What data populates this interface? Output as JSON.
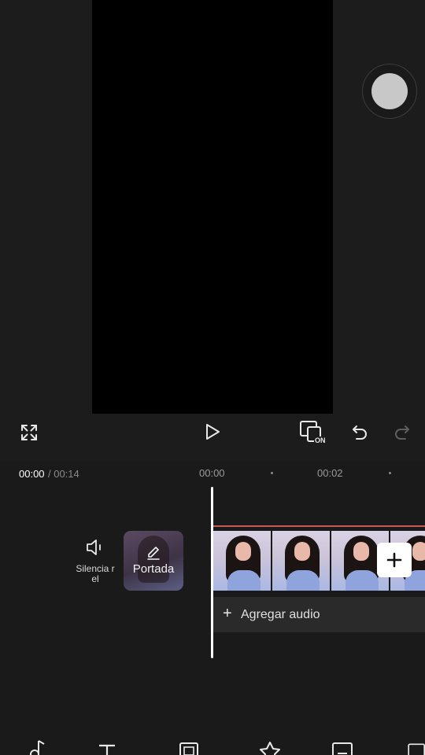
{
  "controls": {
    "fullscreen_icon": "fullscreen-expand-icon",
    "play_icon": "play-icon",
    "ratio_toggle_icon": "ratio-toggle-icon",
    "ratio_toggle_badge": "ON",
    "undo_icon": "undo-icon",
    "redo_icon": "redo-icon"
  },
  "timeline": {
    "current_time": "00:00",
    "total_time": "/ 00:14",
    "ruler_ticks": [
      "00:00",
      "00:02"
    ]
  },
  "track": {
    "mute_label": "Silencia r el",
    "cover_label": "Portada",
    "add_audio_label": "Agregar audio",
    "add_audio_plus": "+",
    "clip_frames": 4
  },
  "toolbar": {
    "items": [
      "music-icon",
      "text-icon",
      "sticker-icon",
      "effects-icon",
      "filters-icon",
      "format-icon"
    ]
  },
  "colors": {
    "background": "#1c1c1c",
    "preview": "#000000",
    "clip_border": "#c75b54",
    "playhead": "#ffffff"
  }
}
